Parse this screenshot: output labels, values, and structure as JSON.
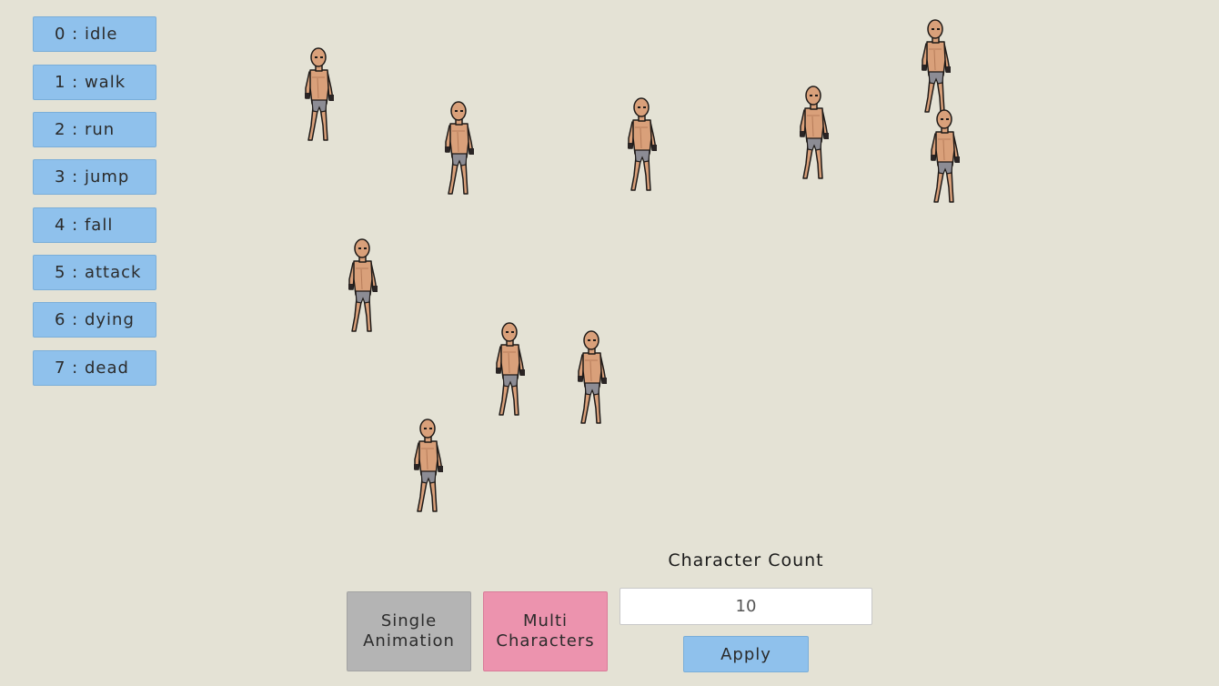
{
  "animation_buttons": [
    {
      "label": "0 : idle"
    },
    {
      "label": "1 : walk"
    },
    {
      "label": "2 : run"
    },
    {
      "label": "3 : jump"
    },
    {
      "label": "4 : fall"
    },
    {
      "label": "5 : attack"
    },
    {
      "label": "6 : dying"
    },
    {
      "label": "7 : dead"
    }
  ],
  "modes": {
    "single_line1": "Single",
    "single_line2": "Animation",
    "multi_line1": "Multi",
    "multi_line2": "Characters"
  },
  "character_count": {
    "label": "Character Count",
    "value": "10"
  },
  "apply_label": "Apply",
  "colors": {
    "background": "#e4e2d5",
    "button_blue": "#8fc1ec",
    "single_gray": "#b4b4b4",
    "multi_pink": "#ec93ae",
    "skin": "#d9a07a",
    "outline": "#1e1a18",
    "underwear": "#8c8c94"
  }
}
